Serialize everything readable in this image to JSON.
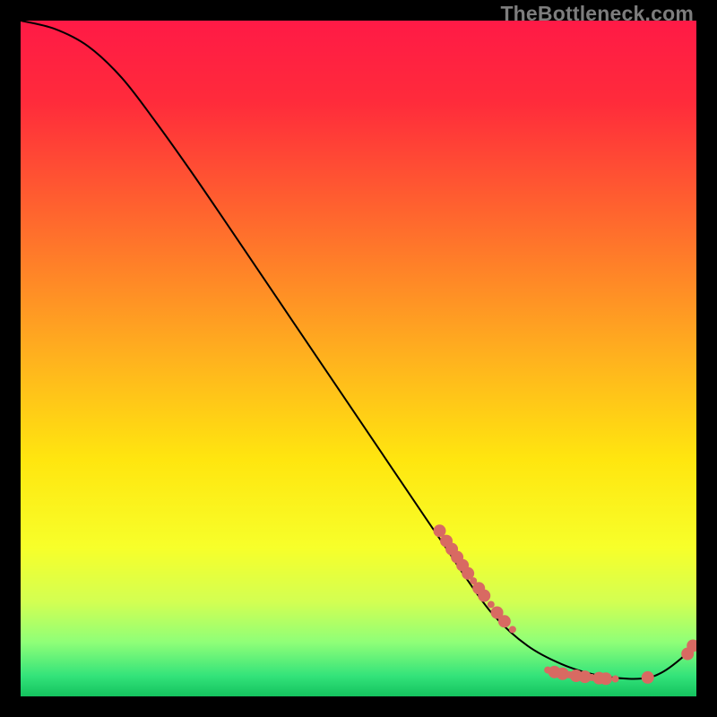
{
  "watermark": "TheBottleneck.com",
  "chart_data": {
    "type": "line",
    "title": "",
    "xlabel": "",
    "ylabel": "",
    "xlim": [
      0,
      100
    ],
    "ylim": [
      0,
      100
    ],
    "grid": false,
    "gradient_stops": [
      {
        "offset": 0.0,
        "color": "#ff1a46"
      },
      {
        "offset": 0.12,
        "color": "#ff2b3b"
      },
      {
        "offset": 0.3,
        "color": "#ff6a2d"
      },
      {
        "offset": 0.5,
        "color": "#ffb21e"
      },
      {
        "offset": 0.65,
        "color": "#ffe60f"
      },
      {
        "offset": 0.78,
        "color": "#f7ff2a"
      },
      {
        "offset": 0.86,
        "color": "#d3ff52"
      },
      {
        "offset": 0.92,
        "color": "#8fff78"
      },
      {
        "offset": 0.97,
        "color": "#33e37a"
      },
      {
        "offset": 1.0,
        "color": "#14c25e"
      }
    ],
    "series": [
      {
        "name": "bottleneck-curve",
        "color": "#000000",
        "x": [
          0,
          5,
          10,
          15,
          20,
          25,
          30,
          35,
          40,
          45,
          50,
          55,
          60,
          63,
          66,
          70,
          75,
          80,
          85,
          90,
          93,
          95,
          97,
          99,
          100
        ],
        "y": [
          100,
          98.8,
          96.2,
          91.5,
          85.0,
          78.0,
          70.7,
          63.3,
          55.9,
          48.5,
          41.1,
          33.7,
          26.3,
          21.9,
          17.4,
          12.0,
          7.5,
          4.8,
          3.2,
          2.6,
          2.8,
          3.6,
          5.0,
          6.8,
          8.1
        ]
      }
    ],
    "markers": {
      "name": "highlight-dots",
      "color": "#d86a62",
      "radius_major": 7,
      "radius_minor": 4,
      "points": [
        {
          "x": 62.0,
          "y": 24.5,
          "r": "major"
        },
        {
          "x": 63.0,
          "y": 23.0,
          "r": "major"
        },
        {
          "x": 63.8,
          "y": 21.8,
          "r": "major"
        },
        {
          "x": 64.6,
          "y": 20.6,
          "r": "major"
        },
        {
          "x": 65.4,
          "y": 19.4,
          "r": "major"
        },
        {
          "x": 66.2,
          "y": 18.2,
          "r": "major"
        },
        {
          "x": 67.0,
          "y": 17.1,
          "r": "minor"
        },
        {
          "x": 67.8,
          "y": 16.0,
          "r": "major"
        },
        {
          "x": 68.6,
          "y": 14.9,
          "r": "major"
        },
        {
          "x": 69.6,
          "y": 13.6,
          "r": "minor"
        },
        {
          "x": 70.5,
          "y": 12.4,
          "r": "major"
        },
        {
          "x": 71.6,
          "y": 11.1,
          "r": "major"
        },
        {
          "x": 72.8,
          "y": 9.9,
          "r": "minor"
        },
        {
          "x": 78.0,
          "y": 3.9,
          "r": "minor"
        },
        {
          "x": 79.0,
          "y": 3.6,
          "r": "major"
        },
        {
          "x": 80.2,
          "y": 3.35,
          "r": "major"
        },
        {
          "x": 81.2,
          "y": 3.2,
          "r": "minor"
        },
        {
          "x": 82.2,
          "y": 3.05,
          "r": "major"
        },
        {
          "x": 83.5,
          "y": 2.9,
          "r": "major"
        },
        {
          "x": 84.5,
          "y": 2.8,
          "r": "minor"
        },
        {
          "x": 85.6,
          "y": 2.7,
          "r": "major"
        },
        {
          "x": 86.6,
          "y": 2.62,
          "r": "major"
        },
        {
          "x": 88.0,
          "y": 2.58,
          "r": "minor"
        },
        {
          "x": 92.8,
          "y": 2.8,
          "r": "major"
        },
        {
          "x": 98.7,
          "y": 6.3,
          "r": "major"
        },
        {
          "x": 99.5,
          "y": 7.5,
          "r": "major"
        }
      ]
    }
  }
}
